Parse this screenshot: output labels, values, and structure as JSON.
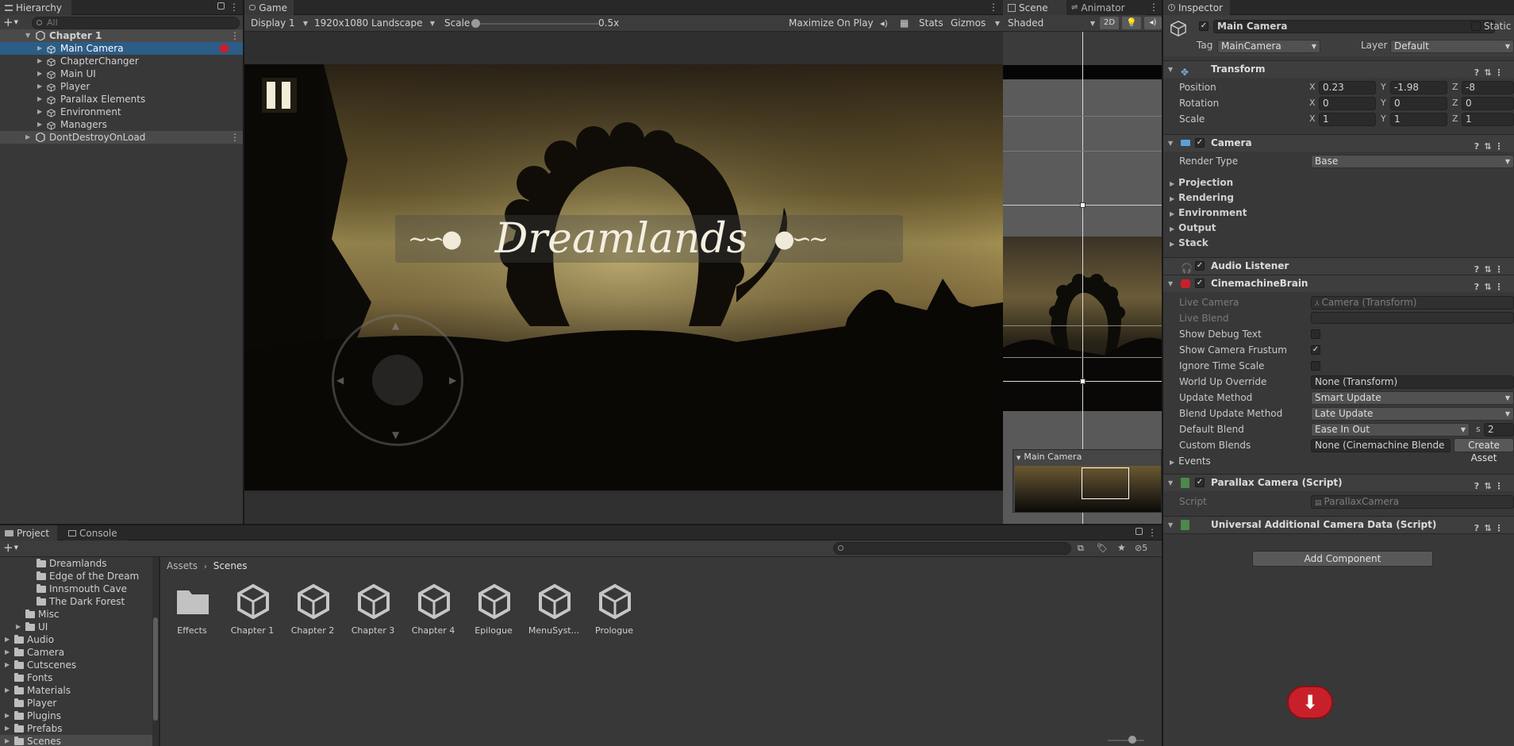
{
  "hierarchy": {
    "tab_label": "Hierarchy",
    "search_placeholder": "All",
    "add_label": "+",
    "items": [
      {
        "label": "Chapter 1"
      },
      {
        "label": "Main Camera"
      },
      {
        "label": "ChapterChanger"
      },
      {
        "label": "Main UI"
      },
      {
        "label": "Player"
      },
      {
        "label": "Parallax Elements"
      },
      {
        "label": "Environment"
      },
      {
        "label": "Managers"
      },
      {
        "label": "DontDestroyOnLoad"
      }
    ]
  },
  "game": {
    "tab_label": "Game",
    "display": "Display 1",
    "resolution": "1920x1080 Landscape",
    "scale_label": "Scale",
    "scale_value": "0.5x",
    "maximize": "Maximize On Play",
    "stats": "Stats",
    "gizmos": "Gizmos",
    "title_text": "Dreamlands",
    "pause_icon": "pause-icon",
    "joystick": "virtual-joystick"
  },
  "scene": {
    "tab_scene": "Scene",
    "tab_animator": "Animator",
    "shading": "Shaded",
    "mode_2d": "2D",
    "camera_preview_title": "Main Camera"
  },
  "project": {
    "tab_project": "Project",
    "tab_console": "Console",
    "add_label": "+",
    "hidden_count": "5",
    "folders": [
      {
        "label": "Dreamlands",
        "indent": 3,
        "arrow": false
      },
      {
        "label": "Edge of the Dream",
        "indent": 3,
        "arrow": false
      },
      {
        "label": "Innsmouth Cave",
        "indent": 3,
        "arrow": false
      },
      {
        "label": "The Dark Forest",
        "indent": 3,
        "arrow": false
      },
      {
        "label": "Misc",
        "indent": 2,
        "arrow": false
      },
      {
        "label": "UI",
        "indent": 2,
        "arrow": true
      },
      {
        "label": "Audio",
        "indent": 1,
        "arrow": true
      },
      {
        "label": "Camera",
        "indent": 1,
        "arrow": true
      },
      {
        "label": "Cutscenes",
        "indent": 1,
        "arrow": true
      },
      {
        "label": "Fonts",
        "indent": 1,
        "arrow": false
      },
      {
        "label": "Materials",
        "indent": 1,
        "arrow": true
      },
      {
        "label": "Player",
        "indent": 1,
        "arrow": false
      },
      {
        "label": "Plugins",
        "indent": 1,
        "arrow": true
      },
      {
        "label": "Prefabs",
        "indent": 1,
        "arrow": true
      },
      {
        "label": "Scenes",
        "indent": 1,
        "arrow": true
      }
    ],
    "breadcrumb": [
      "Assets",
      "Scenes"
    ],
    "assets": [
      {
        "label": "Effects",
        "type": "folder"
      },
      {
        "label": "Chapter 1",
        "type": "unity"
      },
      {
        "label": "Chapter 2",
        "type": "unity"
      },
      {
        "label": "Chapter 3",
        "type": "unity"
      },
      {
        "label": "Chapter 4",
        "type": "unity"
      },
      {
        "label": "Epilogue",
        "type": "unity"
      },
      {
        "label": "MenuSyst...",
        "type": "unity"
      },
      {
        "label": "Prologue",
        "type": "unity"
      }
    ]
  },
  "inspector": {
    "tab_label": "Inspector",
    "object_name": "Main Camera",
    "static_label": "Static",
    "tag_label": "Tag",
    "tag_value": "MainCamera",
    "layer_label": "Layer",
    "layer_value": "Default",
    "transform": {
      "title": "Transform",
      "position_label": "Position",
      "rotation_label": "Rotation",
      "scale_label": "Scale",
      "position": {
        "x": "0.23",
        "y": "-1.98",
        "z": "-8"
      },
      "rotation": {
        "x": "0",
        "y": "0",
        "z": "0"
      },
      "scale": {
        "x": "1",
        "y": "1",
        "z": "1"
      }
    },
    "camera": {
      "title": "Camera",
      "render_type_label": "Render Type",
      "render_type": "Base",
      "foldouts": [
        "Projection",
        "Rendering",
        "Environment",
        "Output",
        "Stack"
      ]
    },
    "audio_listener": {
      "title": "Audio Listener"
    },
    "brain": {
      "title": "CinemachineBrain",
      "live_camera_label": "Live Camera",
      "live_camera": "Camera (Transform)",
      "live_blend_label": "Live Blend",
      "show_debug_text_label": "Show Debug Text",
      "show_debug_text": false,
      "show_camera_frustum_label": "Show Camera Frustum",
      "show_camera_frustum": true,
      "ignore_time_scale_label": "Ignore Time Scale",
      "ignore_time_scale": false,
      "world_up_label": "World Up Override",
      "world_up": "None (Transform)",
      "update_method_label": "Update Method",
      "update_method": "Smart Update",
      "blend_update_label": "Blend Update Method",
      "blend_update": "Late Update",
      "default_blend_label": "Default Blend",
      "default_blend": "Ease In Out",
      "default_blend_s": "s",
      "default_blend_time": "2",
      "custom_blends_label": "Custom Blends",
      "custom_blends": "None (Cinemachine Blende",
      "create_asset": "Create Asset",
      "events_label": "Events"
    },
    "parallax": {
      "title": "Parallax Camera (Script)",
      "script_label": "Script",
      "script_value": "ParallaxCamera"
    },
    "urp": {
      "title": "Universal Additional Camera Data (Script)"
    },
    "add_component": "Add Component"
  },
  "colors": {
    "selection": "#2c5d87",
    "panel": "#383838",
    "accent_red": "#c8202a"
  }
}
